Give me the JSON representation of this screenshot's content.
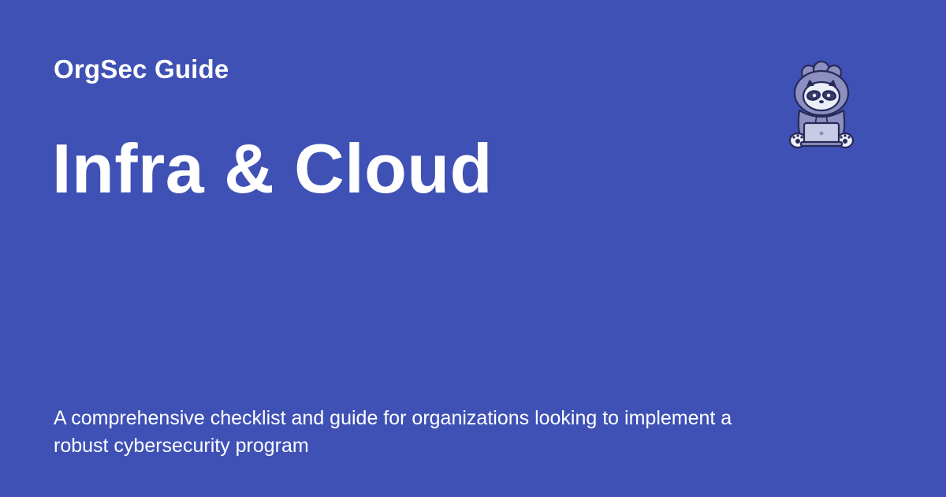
{
  "site": {
    "name": "OrgSec Guide"
  },
  "page": {
    "title": "Infra & Cloud",
    "description": "A comprehensive checklist and guide for organizations looking to implement a robust cybersecurity program"
  },
  "logo": {
    "icon": "hacker-raccoon-mascot-icon"
  },
  "colors": {
    "background": "#3f51b5",
    "text": "#ffffff",
    "mascot_hood": "#8c8fbf",
    "mascot_outline": "#272a57",
    "mascot_laptop": "#c9cbe6"
  }
}
